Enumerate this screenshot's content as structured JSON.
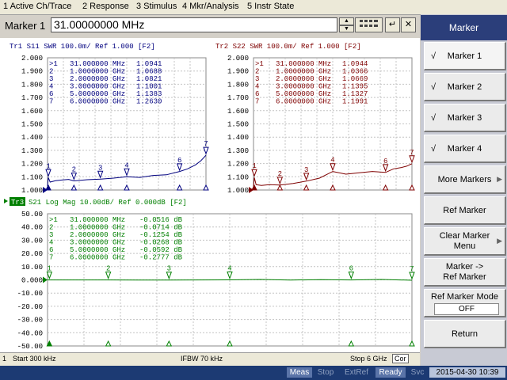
{
  "menu": [
    "1 Active Ch/Trace",
    "2 Response",
    "3 Stimulus",
    "4 Mkr/Analysis",
    "5 Instr State"
  ],
  "marker_entry": {
    "label": "Marker 1",
    "value": "31.00000000 MHz"
  },
  "toolbar_icons": [
    "spin-up-icon",
    "spin-down-icon",
    "numeric-keypad-icon",
    "enter-icon",
    "close-icon"
  ],
  "softkeys": {
    "title": "Marker",
    "marker1": "Marker 1",
    "marker2": "Marker 2",
    "marker3": "Marker 3",
    "marker4": "Marker 4",
    "check": "√",
    "more_markers": "More Markers",
    "ref_marker": "Ref Marker",
    "clear_marker_menu_1": "Clear Marker",
    "clear_marker_menu_2": "Menu",
    "marker_to_ref_1": "Marker ->",
    "marker_to_ref_2": "Ref Marker",
    "ref_marker_mode": "Ref Marker Mode",
    "ref_marker_mode_value": "OFF",
    "return": "Return"
  },
  "status1": {
    "channel": "1",
    "start": "Start 300 kHz",
    "ifbw": "IFBW 70 kHz",
    "stop": "Stop 6 GHz",
    "cor": "Cor"
  },
  "status2": {
    "meas": "Meas",
    "stop": "Stop",
    "extref": "ExtRef",
    "ready": "Ready",
    "svc": "Svc",
    "datetime": "2015-04-30 10:39"
  },
  "colors": {
    "tr1": "#00007f",
    "tr2": "#7f0000",
    "tr3": "#007f00",
    "grid": "#b8b8b8",
    "title_bar": "#2b3e7a"
  },
  "chart_data": [
    {
      "type": "line",
      "title": "Tr1  S11  SWR 100.0m/ Ref 1.000 [F2]",
      "trace_label": "Tr1",
      "color": "#00007f",
      "yticks": [
        "2.000",
        "1.900",
        "1.800",
        "1.700",
        "1.600",
        "1.500",
        "1.400",
        "1.300",
        "1.200",
        "1.100",
        "1.000"
      ],
      "ylim": [
        1.0,
        2.0
      ],
      "xlim": [
        0.0003,
        6.0
      ],
      "x_unit": "GHz",
      "series": [
        {
          "x": [
            0.0003,
            0.031,
            0.1,
            0.3,
            0.5,
            0.8,
            1.0,
            1.5,
            2.0,
            2.5,
            3.0,
            3.5,
            4.0,
            4.5,
            5.0,
            5.3,
            5.6,
            5.8,
            6.0
          ],
          "y": [
            1.03,
            1.094,
            1.06,
            1.07,
            1.075,
            1.08,
            1.069,
            1.078,
            1.082,
            1.09,
            1.1,
            1.095,
            1.11,
            1.115,
            1.14,
            1.16,
            1.19,
            1.22,
            1.263
          ]
        }
      ],
      "markers": [
        {
          "id": "1",
          "active": true,
          "x_text": "31.000000 MHz",
          "x": 0.031,
          "y": 1.0941
        },
        {
          "id": "2",
          "active": false,
          "x_text": "1.0000000 GHz",
          "x": 1.0,
          "y": 1.0688
        },
        {
          "id": "3",
          "active": false,
          "x_text": "2.0000000 GHz",
          "x": 2.0,
          "y": 1.0821
        },
        {
          "id": "4",
          "active": false,
          "x_text": "3.0000000 GHz",
          "x": 3.0,
          "y": 1.1001
        },
        {
          "id": "6",
          "active": false,
          "x_text": "5.0000000 GHz",
          "x": 5.0,
          "y": 1.1383
        },
        {
          "id": "7",
          "active": false,
          "x_text": "6.0000000 GHz",
          "x": 6.0,
          "y": 1.263
        }
      ],
      "marker_table": [
        {
          "id": ">1",
          "freq": "31.000000 MHz",
          "val": "1.0941"
        },
        {
          "id": "2",
          "freq": "1.0000000 GHz",
          "val": "1.0688"
        },
        {
          "id": "3",
          "freq": "2.0000000 GHz",
          "val": "1.0821"
        },
        {
          "id": "4",
          "freq": "3.0000000 GHz",
          "val": "1.1001"
        },
        {
          "id": "6",
          "freq": "5.0000000 GHz",
          "val": "1.1383"
        },
        {
          "id": "7",
          "freq": "6.0000000 GHz",
          "val": "1.2630"
        }
      ]
    },
    {
      "type": "line",
      "title": "Tr2  S22  SWR 100.0m/ Ref 1.000 [F2]",
      "trace_label": "Tr2",
      "color": "#7f0000",
      "yticks": [
        "2.000",
        "1.900",
        "1.800",
        "1.700",
        "1.600",
        "1.500",
        "1.400",
        "1.300",
        "1.200",
        "1.100",
        "1.000"
      ],
      "ylim": [
        1.0,
        2.0
      ],
      "xlim": [
        0.0003,
        6.0
      ],
      "x_unit": "GHz",
      "series": [
        {
          "x": [
            0.0003,
            0.031,
            0.1,
            0.3,
            0.6,
            1.0,
            1.5,
            2.0,
            2.5,
            3.0,
            3.5,
            4.0,
            4.5,
            5.0,
            5.3,
            5.6,
            5.8,
            6.0
          ],
          "y": [
            1.02,
            1.094,
            1.04,
            1.035,
            1.04,
            1.037,
            1.05,
            1.067,
            1.09,
            1.14,
            1.12,
            1.13,
            1.14,
            1.133,
            1.16,
            1.17,
            1.18,
            1.199
          ]
        }
      ],
      "markers": [
        {
          "id": "1",
          "active": true,
          "x_text": "31.000000 MHz",
          "x": 0.031,
          "y": 1.0944
        },
        {
          "id": "2",
          "active": false,
          "x_text": "1.0000000 GHz",
          "x": 1.0,
          "y": 1.0366
        },
        {
          "id": "3",
          "active": false,
          "x_text": "2.0000000 GHz",
          "x": 2.0,
          "y": 1.0669
        },
        {
          "id": "4",
          "active": false,
          "x_text": "3.0000000 GHz",
          "x": 3.0,
          "y": 1.1395
        },
        {
          "id": "6",
          "active": false,
          "x_text": "5.0000000 GHz",
          "x": 5.0,
          "y": 1.1327
        },
        {
          "id": "7",
          "active": false,
          "x_text": "6.0000000 GHz",
          "x": 6.0,
          "y": 1.1991
        }
      ],
      "marker_table": [
        {
          "id": ">1",
          "freq": "31.000000 MHz",
          "val": "1.0944"
        },
        {
          "id": "2",
          "freq": "1.0000000 GHz",
          "val": "1.0366"
        },
        {
          "id": "3",
          "freq": "2.0000000 GHz",
          "val": "1.0669"
        },
        {
          "id": "4",
          "freq": "3.0000000 GHz",
          "val": "1.1395"
        },
        {
          "id": "6",
          "freq": "5.0000000 GHz",
          "val": "1.1327"
        },
        {
          "id": "7",
          "freq": "6.0000000 GHz",
          "val": "1.1991"
        }
      ]
    },
    {
      "type": "line",
      "title": "S21  Log Mag 10.00dB/ Ref 0.000dB [F2]",
      "trace_label": "Tr3",
      "color": "#007f00",
      "yticks": [
        "50.00",
        "40.00",
        "30.00",
        "20.00",
        "10.00",
        "0.000",
        "-10.00",
        "-20.00",
        "-30.00",
        "-40.00",
        "-50.00"
      ],
      "ylim": [
        -50,
        50
      ],
      "xlim": [
        0.0003,
        6.0
      ],
      "x_unit": "GHz",
      "series": [
        {
          "x": [
            0.0003,
            0.031,
            0.5,
            1.0,
            1.5,
            2.0,
            2.5,
            3.0,
            3.5,
            4.0,
            4.5,
            5.0,
            5.5,
            6.0
          ],
          "y": [
            -0.05,
            -0.0516,
            -0.06,
            -0.0714,
            -0.1,
            -0.1254,
            -0.06,
            -0.0268,
            0.3,
            -0.2,
            0.2,
            -0.0592,
            0.3,
            -0.2777
          ]
        }
      ],
      "markers": [
        {
          "id": "1",
          "active": true,
          "x_text": "31.000000 MHz",
          "x": 0.031,
          "y": -0.0516
        },
        {
          "id": "2",
          "active": false,
          "x_text": "1.0000000 GHz",
          "x": 1.0,
          "y": -0.0714
        },
        {
          "id": "3",
          "active": false,
          "x_text": "2.0000000 GHz",
          "x": 2.0,
          "y": -0.1254
        },
        {
          "id": "4",
          "active": false,
          "x_text": "3.0000000 GHz",
          "x": 3.0,
          "y": -0.0268
        },
        {
          "id": "6",
          "active": false,
          "x_text": "5.0000000 GHz",
          "x": 5.0,
          "y": -0.0592
        },
        {
          "id": "7",
          "active": false,
          "x_text": "6.0000000 GHz",
          "x": 6.0,
          "y": -0.2777
        }
      ],
      "marker_table": [
        {
          "id": ">1",
          "freq": "31.000000 MHz",
          "val": "-0.0516 dB"
        },
        {
          "id": "2",
          "freq": "1.0000000 GHz",
          "val": "-0.0714 dB"
        },
        {
          "id": "3",
          "freq": "2.0000000 GHz",
          "val": "-0.1254 dB"
        },
        {
          "id": "4",
          "freq": "3.0000000 GHz",
          "val": "-0.0268 dB"
        },
        {
          "id": "6",
          "freq": "5.0000000 GHz",
          "val": "-0.0592 dB"
        },
        {
          "id": "7",
          "freq": "6.0000000 GHz",
          "val": "-0.2777 dB"
        }
      ]
    }
  ]
}
